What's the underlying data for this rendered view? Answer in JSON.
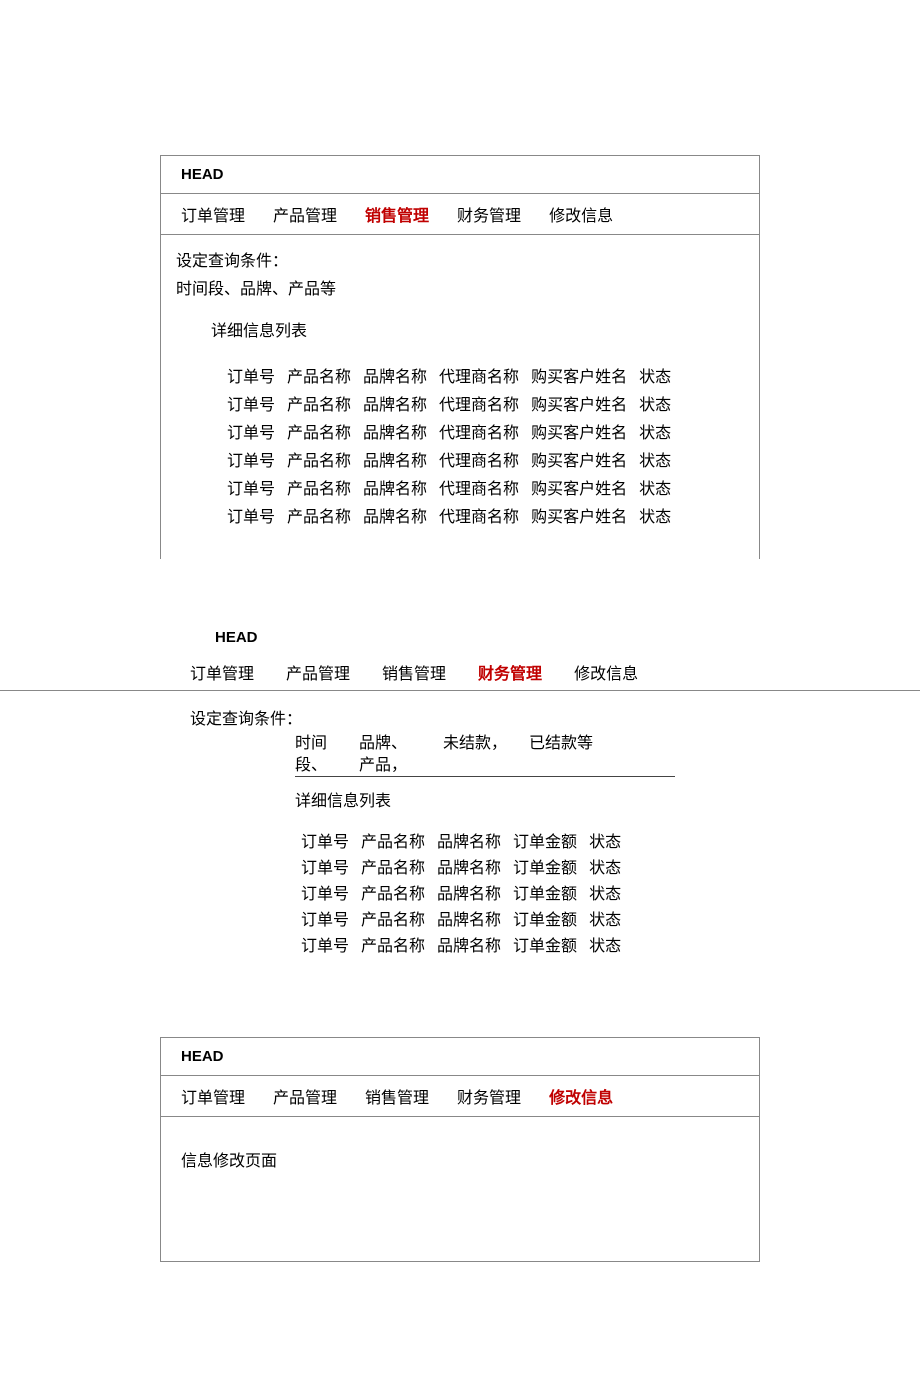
{
  "shared": {
    "head_label": "HEAD",
    "nav": {
      "orders": "订单管理",
      "products": "产品管理",
      "sales": "销售管理",
      "finance": "财务管理",
      "modify": "修改信息"
    },
    "query_title": "设定查询条件：",
    "detail_list_title": "详细信息列表"
  },
  "block1": {
    "query_sub": "时间段、品牌、产品等",
    "cols": [
      "订单号",
      "产品名称",
      "品牌名称",
      "代理商名称",
      "购买客户姓名",
      "状态"
    ],
    "row_count": 6
  },
  "block2": {
    "conds": {
      "c1": "时间段、",
      "c2": "品牌、产品，",
      "c3": "未结款，",
      "c4": "已结款等"
    },
    "cols": [
      "订单号",
      "产品名称",
      "品牌名称",
      "订单金额",
      "状态"
    ],
    "row_count": 5
  },
  "block3": {
    "body_text": "信息修改页面"
  }
}
